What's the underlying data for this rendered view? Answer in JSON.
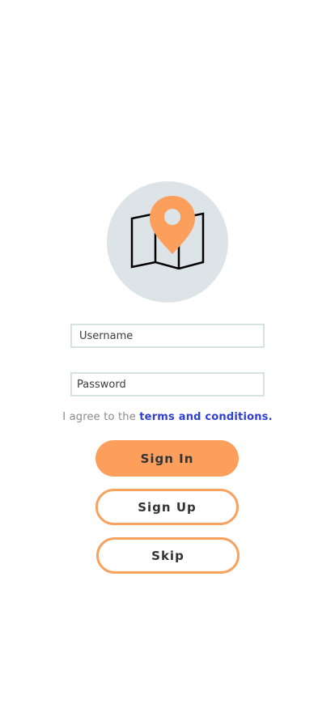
{
  "logo": {
    "icon": "map-pin-icon",
    "circle_color": "#dde4e7",
    "pin_color": "#fd9f5c"
  },
  "form": {
    "username_placeholder": "Username",
    "password_placeholder": "Password",
    "terms_prefix": "I agree to the ",
    "terms_link": "terms and conditions."
  },
  "buttons": {
    "sign_in": "Sign In",
    "sign_up": "Sign Up",
    "skip": "Skip"
  },
  "colors": {
    "accent": "#fd9f5c",
    "link": "#2f3fd0",
    "field_border": "#d5e3df"
  }
}
